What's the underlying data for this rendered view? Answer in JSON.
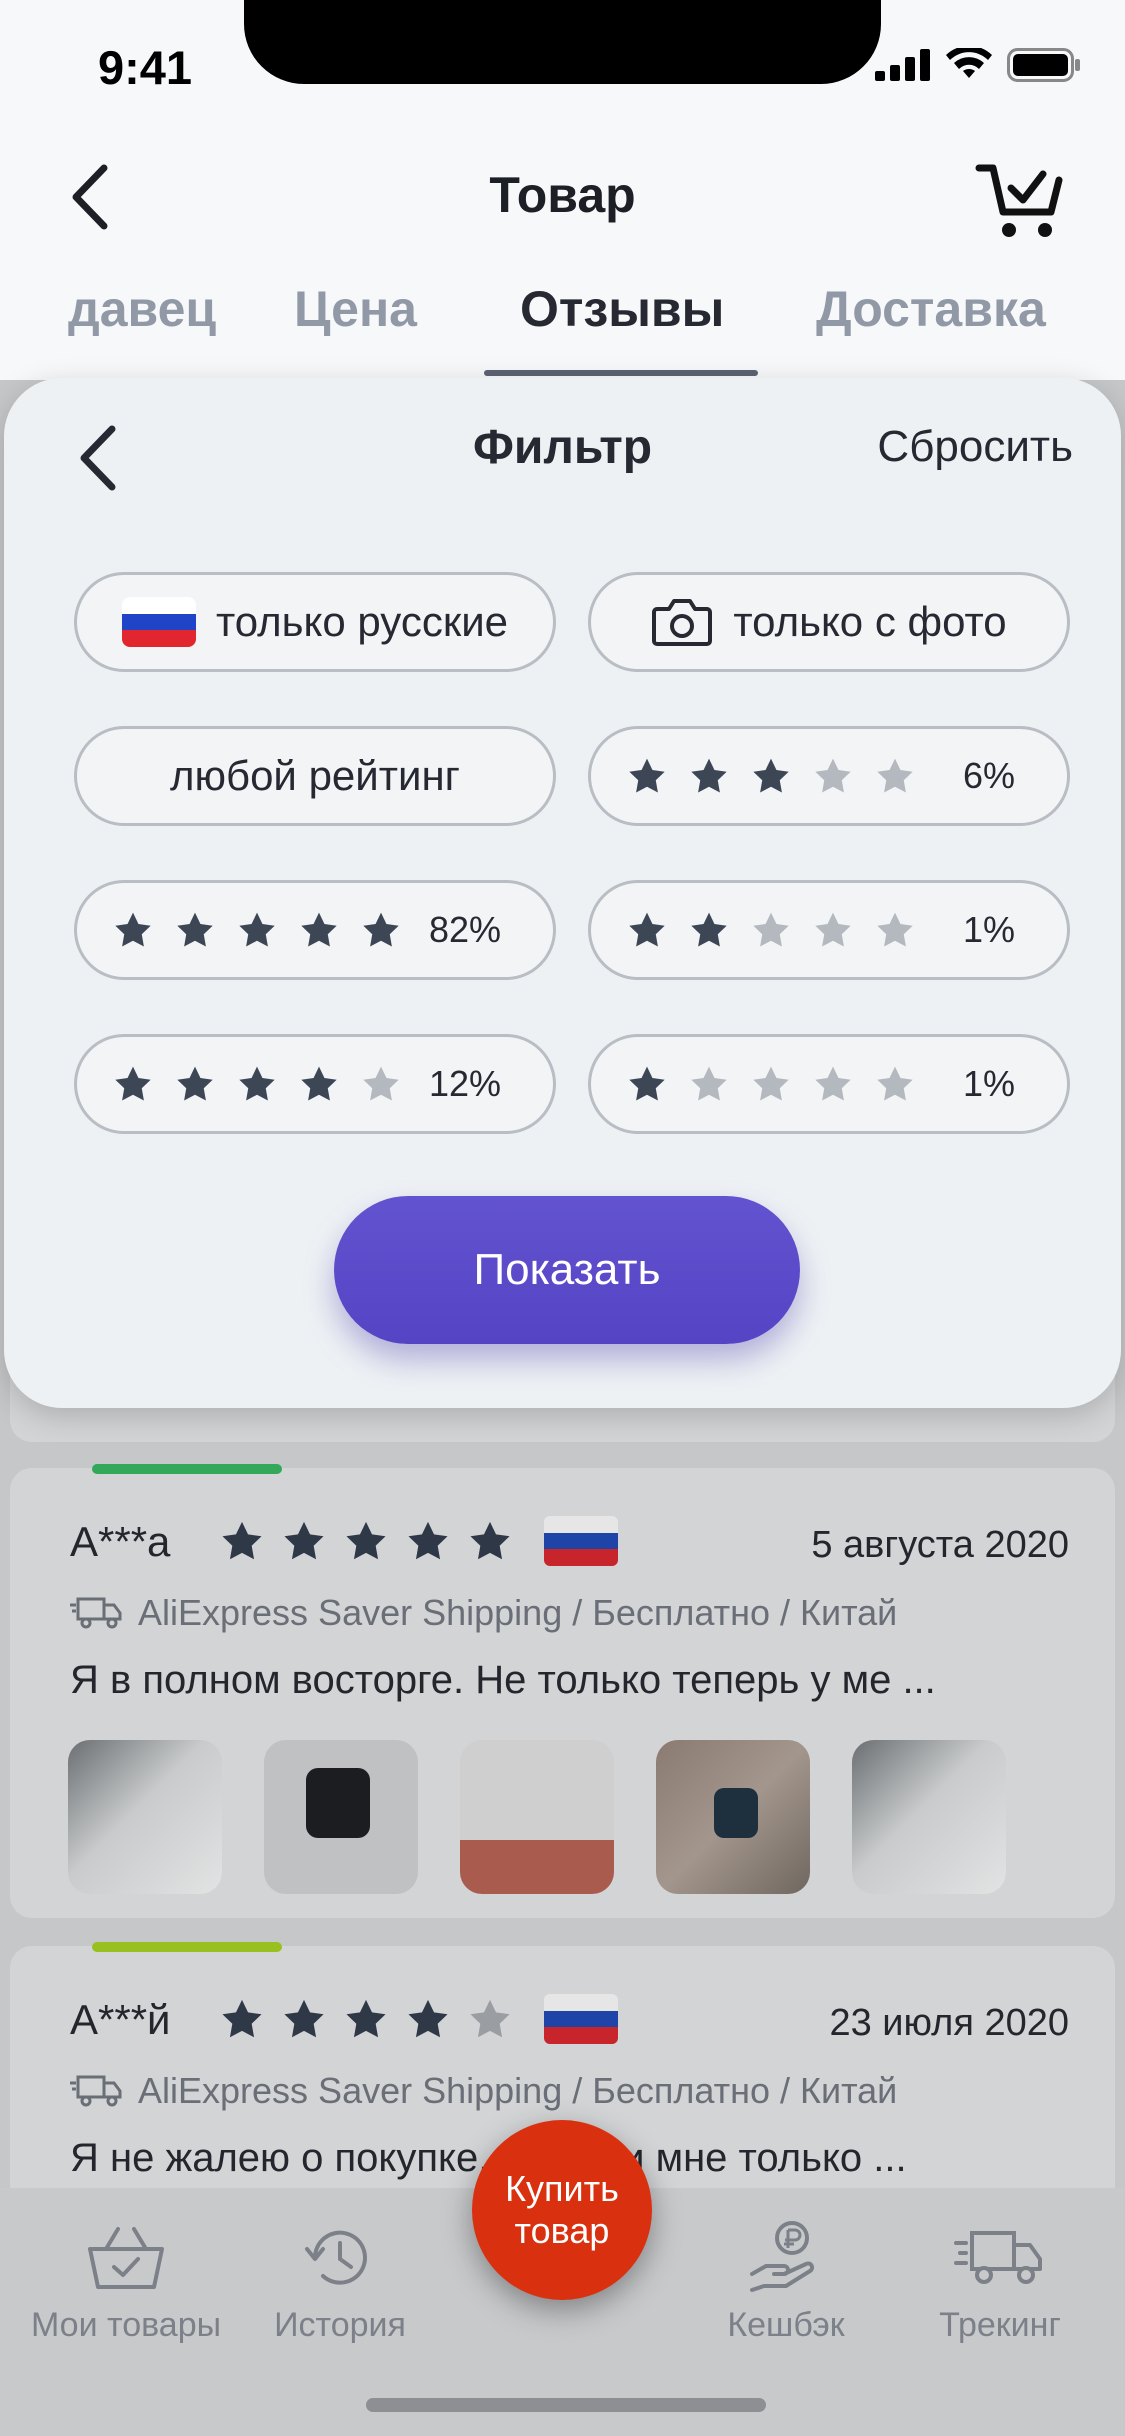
{
  "status": {
    "time": "9:41"
  },
  "header": {
    "title": "Товар"
  },
  "tabs": [
    {
      "label": "давец",
      "active": false
    },
    {
      "label": "Цена",
      "active": false
    },
    {
      "label": "Отзывы",
      "active": true
    },
    {
      "label": "Доставка",
      "active": false
    }
  ],
  "filter": {
    "title": "Фильтр",
    "reset_label": "Сбросить",
    "chips": {
      "russian": "только русские",
      "photo": "только с фото",
      "any_rating": "любой рейтинг"
    },
    "ratings": [
      {
        "stars": 5,
        "percent": "82%"
      },
      {
        "stars": 4,
        "percent": "12%"
      },
      {
        "stars": 3,
        "percent": "6%"
      },
      {
        "stars": 2,
        "percent": "1%"
      },
      {
        "stars": 1,
        "percent": "1%"
      }
    ],
    "show_label": "Показать"
  },
  "reviews": [
    {
      "author": "А***а",
      "rating": 5,
      "date": "5 августа 2020",
      "shipping": "AliExpress Saver Shipping / Бесплатно / Китай",
      "text": "Я в полном восторге. Не только теперь у ме ..."
    },
    {
      "author": "А***й",
      "rating": 4,
      "date": "23 июля 2020",
      "shipping": "AliExpress Saver Shipping / Бесплатно / Китай",
      "text": "Я не жалею о покупке, пришли мне только  ..."
    }
  ],
  "bottom_nav": {
    "my_items": "Мои товары",
    "history": "История",
    "buy_line1": "Купить",
    "buy_line2": "товар",
    "cashback": "Кешбэк",
    "tracking": "Трекинг"
  },
  "colors": {
    "accent": "#5848c8",
    "buy": "#d9300f",
    "star_active": "#3c4655",
    "star_inactive": "#b4b8bf"
  }
}
